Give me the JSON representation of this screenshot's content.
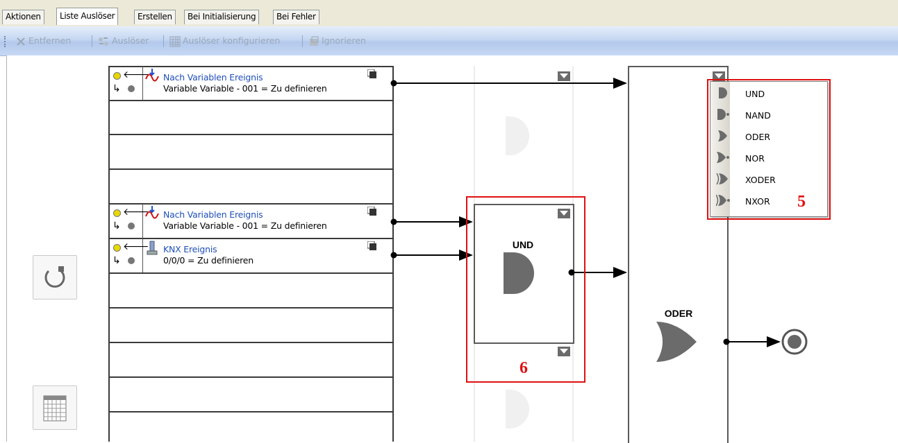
{
  "tabs": [
    {
      "label": "Aktionen",
      "active": false
    },
    {
      "label": "Liste Auslöser",
      "active": true
    },
    {
      "label": "Erstellen",
      "active": false
    },
    {
      "label": "Bei Initialisierung",
      "active": false
    },
    {
      "label": "Bei Fehler",
      "active": false
    }
  ],
  "toolbar": {
    "remove_label": "Entfernen",
    "trigger_label": "Auslöser",
    "configure_label": "Auslöser konfigurieren",
    "ignore_label": "Ignorieren"
  },
  "triggers": [
    {
      "title": "Nach Variablen Ereignis",
      "description": "Variable Variable - 001 = Zu definieren",
      "icon": "variable-event-icon"
    },
    {
      "title": "Nach Variablen Ereignis",
      "description": "Variable Variable - 001 = Zu definieren",
      "icon": "variable-event-icon"
    },
    {
      "title": "KNX Ereignis",
      "description": "0/0/0 = Zu definieren",
      "icon": "knx-event-icon"
    }
  ],
  "gates": {
    "middle": {
      "label": "UND"
    },
    "right": {
      "label": "ODER"
    }
  },
  "gate_menu": {
    "items": [
      "UND",
      "NAND",
      "ODER",
      "NOR",
      "XODER",
      "NXOR"
    ]
  },
  "annotations": {
    "menu_number": "5",
    "gate_number": "6"
  },
  "colors": {
    "annotation_red": "#e01010",
    "link_blue": "#1f4fb8",
    "gate_gray": "#6b6b6b"
  }
}
